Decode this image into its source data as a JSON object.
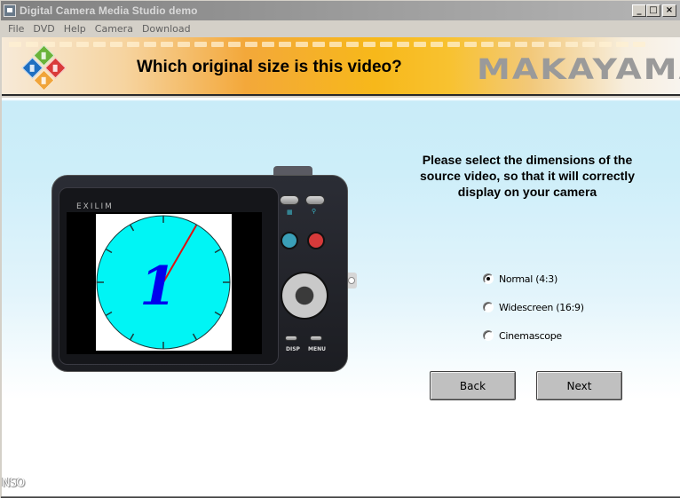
{
  "window": {
    "title": "Digital Camera Media Studio demo",
    "controls": {
      "minimize": "_",
      "maximize": "□",
      "close": "×"
    }
  },
  "menubar": {
    "items": [
      {
        "label": "File"
      },
      {
        "label": "DVD"
      },
      {
        "label": "Help"
      },
      {
        "label": "Camera"
      },
      {
        "label": "Download"
      }
    ]
  },
  "banner": {
    "title": "Which original size is this video?",
    "brand": "MAKAYAMA",
    "logo_colors": [
      "#6ab33a",
      "#1f6fc1",
      "#d93a3a",
      "#f0a43a"
    ]
  },
  "camera": {
    "brand_label": "EXILIM",
    "button_labels": {
      "disp": "DISP",
      "menu": "MENU"
    },
    "preview_digit": "1",
    "preview_colors": {
      "dial": "#00f5f5",
      "digit": "#0000ee",
      "hand": "#e01010"
    }
  },
  "instructions": {
    "text": "Please select the dimensions of the source video, so that it will correctly display on your camera"
  },
  "options": {
    "selected": "Normal (4:3)",
    "items": [
      {
        "label": "Normal (4:3)",
        "checked": true
      },
      {
        "label": "Widescreen (16:9)",
        "checked": false
      },
      {
        "label": "Cinemascope",
        "checked": false
      }
    ]
  },
  "buttons": {
    "back": "Back",
    "next": "Next"
  },
  "footer": {
    "corner_text": "NSO"
  }
}
